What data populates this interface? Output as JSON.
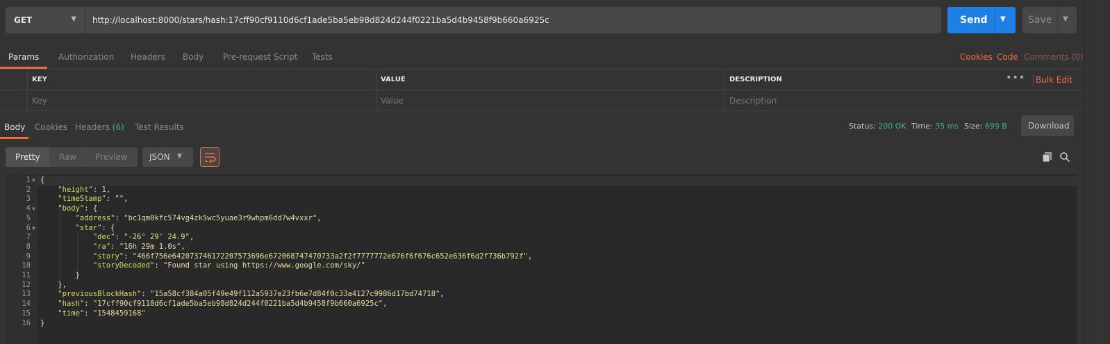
{
  "request": {
    "method": "GET",
    "url": "http://localhost:8000/stars/hash:17cff90cf9110d6cf1ade5ba5eb98d824d244f0221ba5d4b9458f9b660a6925c",
    "send_label": "Send",
    "save_label": "Save"
  },
  "request_tabs": [
    "Params",
    "Authorization",
    "Headers",
    "Body",
    "Pre-request Script",
    "Tests"
  ],
  "request_links": {
    "cookies": "Cookies",
    "code": "Code",
    "comments": "Comments (0)"
  },
  "params": {
    "headers": {
      "key": "KEY",
      "value": "VALUE",
      "description": "DESCRIPTION"
    },
    "placeholders": {
      "key": "Key",
      "value": "Value",
      "description": "Description"
    },
    "bulk_edit": "Bulk Edit",
    "more": "•••"
  },
  "response_tabs": {
    "body": "Body",
    "cookies": "Cookies",
    "headers": "Headers",
    "headers_count": "(6)",
    "test_results": "Test Results"
  },
  "response_meta": {
    "status_label": "Status:",
    "status": "200 OK",
    "time_label": "Time:",
    "time": "35 ms",
    "size_label": "Size:",
    "size": "699 B",
    "download": "Download"
  },
  "viewer": {
    "pretty": "Pretty",
    "raw": "Raw",
    "preview": "Preview",
    "format": "JSON"
  },
  "code_lines": [
    {
      "n": "1",
      "fold": true,
      "html": "{"
    },
    {
      "n": "2",
      "fold": false,
      "html": "    <span class=\"k\">\"height\"</span>: <span class=\"n\">1</span>,"
    },
    {
      "n": "3",
      "fold": false,
      "html": "    <span class=\"k\">\"timeStamp\"</span>: <span class=\"s\">\"\"</span>,"
    },
    {
      "n": "4",
      "fold": true,
      "html": "    <span class=\"k\">\"body\"</span>: {"
    },
    {
      "n": "5",
      "fold": false,
      "html": "        <span class=\"k\">\"address\"</span>: <span class=\"s\">\"bc1qm0kfc574vg4zk5wc5yuae3r9whpm6dd7w4vxxr\"</span>,"
    },
    {
      "n": "6",
      "fold": true,
      "html": "        <span class=\"k\">\"star\"</span>: {"
    },
    {
      "n": "7",
      "fold": false,
      "html": "            <span class=\"k\">\"dec\"</span>: <span class=\"s\">\"-26° 29' 24.9\"</span>,"
    },
    {
      "n": "8",
      "fold": false,
      "html": "            <span class=\"k\">\"ra\"</span>: <span class=\"s\">\"16h 29m 1.0s\"</span>,"
    },
    {
      "n": "9",
      "fold": false,
      "html": "            <span class=\"k\">\"story\"</span>: <span class=\"s\">\"466f756e642073746172207573696e672068747470733a2f2f7777772e676f6f676c652e636f6d2f736b792f\"</span>,"
    },
    {
      "n": "10",
      "fold": false,
      "html": "            <span class=\"k\">\"storyDecoded\"</span>: <span class=\"s\">\"Found star using https://www.google.com/sky/\"</span>"
    },
    {
      "n": "11",
      "fold": false,
      "html": "        }"
    },
    {
      "n": "12",
      "fold": false,
      "html": "    },"
    },
    {
      "n": "13",
      "fold": false,
      "html": "    <span class=\"k\">\"previousBlockHash\"</span>: <span class=\"s\">\"15a58cf384a05f49e49f112a5937e23fb6e7d84f0c33a4127c9986d17bd74718\"</span>,"
    },
    {
      "n": "14",
      "fold": false,
      "html": "    <span class=\"k\">\"hash\"</span>: <span class=\"s\">\"17cff90cf9110d6cf1ade5ba5eb98d824d244f0221ba5d4b9458f9b660a6925c\"</span>,"
    },
    {
      "n": "15",
      "fold": false,
      "html": "    <span class=\"k\">\"time\"</span>: <span class=\"s\">\"1548459168\"</span>"
    },
    {
      "n": "16",
      "fold": false,
      "html": "}"
    }
  ]
}
